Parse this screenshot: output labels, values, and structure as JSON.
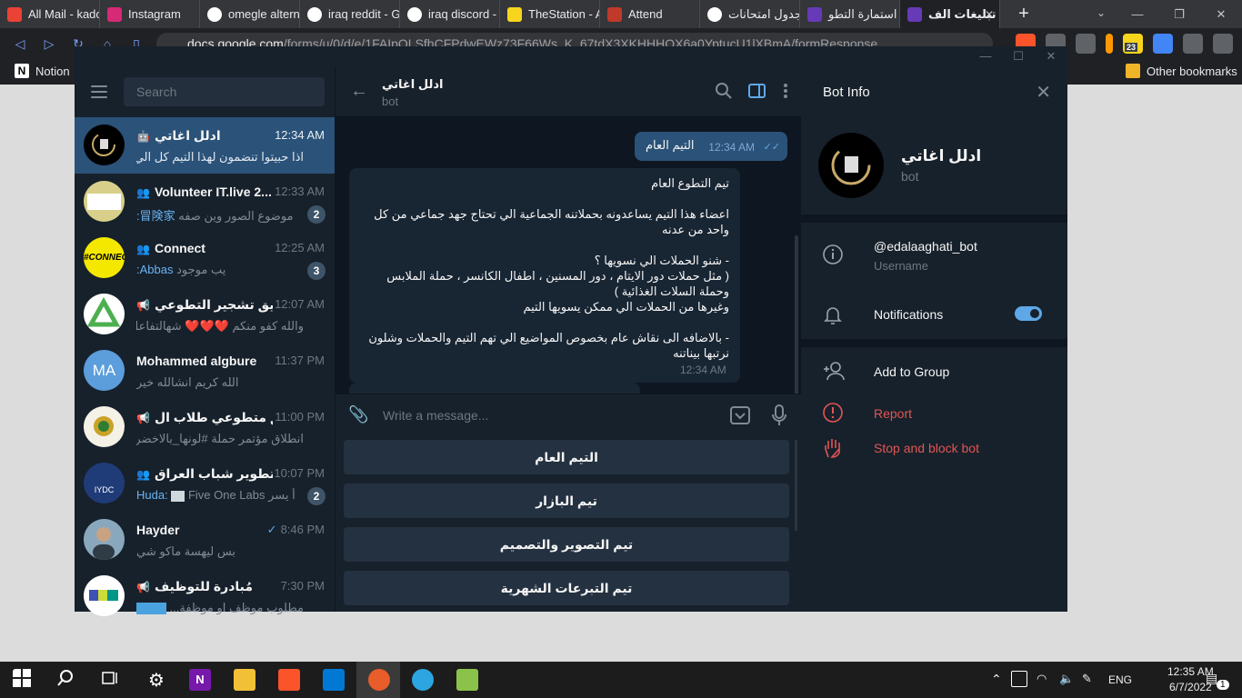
{
  "browser": {
    "tabs": [
      {
        "label": "All Mail - kado",
        "color": "#ea4335"
      },
      {
        "label": "Instagram",
        "color": "#d62976"
      },
      {
        "label": "omegle altern",
        "color": "#4285f4"
      },
      {
        "label": "iraq reddit - G",
        "color": "#4285f4"
      },
      {
        "label": "iraq discord -",
        "color": "#4285f4"
      },
      {
        "label": "TheStation - A",
        "color": "#f7d51d"
      },
      {
        "label": "Attend",
        "color": "#c0392b"
      },
      {
        "label": "جدول امتحانات",
        "color": "#4285f4"
      },
      {
        "label": "استمارة التطو",
        "color": "#673ab7"
      },
      {
        "label": "تبليغات الف",
        "color": "#673ab7"
      }
    ],
    "url_domain": "docs.google.com",
    "url_path": "/forms/u/0/d/e/1FAIpQLSfhCFPdwEWz73F66Ws_K_67tdX3XKHHHOX6a0YptucU1lXBmA/formResponse",
    "bookmarks": [
      {
        "label": "Notion"
      },
      {
        "label": "Other bookmarks"
      }
    ],
    "ext_badge": "23"
  },
  "telegram": {
    "search_placeholder": "Search",
    "chats": [
      {
        "name": "ادلل اغاتي",
        "time": "12:34 AM",
        "preview": "اذا حبيتوا تنضمون لهذا التيم  كل الي ع...",
        "avatar_color": "#000000",
        "active": true,
        "badge": ""
      },
      {
        "name": "Volunteer IT.live 2...",
        "time": "12:33 AM",
        "sender": "冒険家:",
        "preview": "موضوع الصور وين صفه",
        "avatar_color": "#d8d08a",
        "badge": "2"
      },
      {
        "name": "Connect",
        "time": "12:25 AM",
        "sender": "Abbas:",
        "preview": "يب موجود",
        "avatar_color": "#f5e800",
        "badge": "3"
      },
      {
        "name": "فريق تشجير التطوعي",
        "time": "12:07 AM",
        "preview": "والله كفو منكم ❤️❤️❤️ شهالتفاعل ا",
        "avatar_color": "#ffffff",
        "badge": ""
      },
      {
        "name": "Mohammed algbure",
        "time": "11:37 PM",
        "preview": "الله كريم انشالله خير",
        "avatar_initials": "MA",
        "avatar_color": "#5c9ddb",
        "badge": ""
      },
      {
        "name": "فريق متطوعي طلاب ال...",
        "time": "11:00 PM",
        "preview": "انطلاق مؤتمر حملة #لونها_بالاخضر...",
        "avatar_color": "#f4f1e6",
        "badge": ""
      },
      {
        "name": "مركز تطوير شباب العراق",
        "time": "10:07 PM",
        "sender": "Huda:",
        "preview": "Five One Labs أ يسر",
        "avatar_color": "#1f3b78",
        "badge": "2"
      },
      {
        "name": "Hayder",
        "time": "8:46 PM",
        "preview": "بس ليهسة ماكو شي",
        "avatar_color": "#8aa8bd",
        "badge": ""
      },
      {
        "name": "مُبادرة للتوظيف",
        "time": "7:30 PM",
        "preview": "مطلوب موظف او موظفة...",
        "avatar_color": "#ffffff",
        "badge": ""
      }
    ],
    "chat_header": {
      "name": "ادلل اغاتي",
      "subtitle": "bot"
    },
    "out_message": {
      "text": "التيم العام",
      "time": "12:34 AM"
    },
    "in_message": {
      "paragraphs": [
        "تيم التطوع العام",
        "اعضاء هذا التيم يساعدونه بحملاتنه الجماعية الي تحتاج جهد جماعي من كل واحد من عدنه",
        "- شنو الحملات الي نسويها ؟\n( مثل حملات دور الايتام ، دور المسنين ، اطفال الكانسر ، حملة الملابس وحملة السلات الغذائية )\nوغيرها من الحملات الي ممكن يسويها التيم",
        "- بالاضافه الى نقاش عام بخصوص المواضيع الي تهم التيم والحملات وشلون نرتبها بيناتنه"
      ],
      "time": "12:34 AM"
    },
    "composer_placeholder": "Write a message...",
    "keyboard_buttons": [
      "التيم العام",
      "تيم البازار",
      "تيم التصوير والتصميم",
      "تيم التبرعات الشهرية"
    ],
    "info": {
      "title": "Bot Info",
      "name": "ادلل اغاتي",
      "subtitle": "bot",
      "username": "@edalaaghati_bot",
      "username_label": "Username",
      "notifications_label": "Notifications",
      "notifications_on": true,
      "add_to_group": "Add to Group",
      "report": "Report",
      "stop_block": "Stop and block bot"
    }
  },
  "taskbar": {
    "time": "12:35 AM",
    "date": "6/7/2022",
    "lang": "ENG",
    "notif_count": "1"
  }
}
